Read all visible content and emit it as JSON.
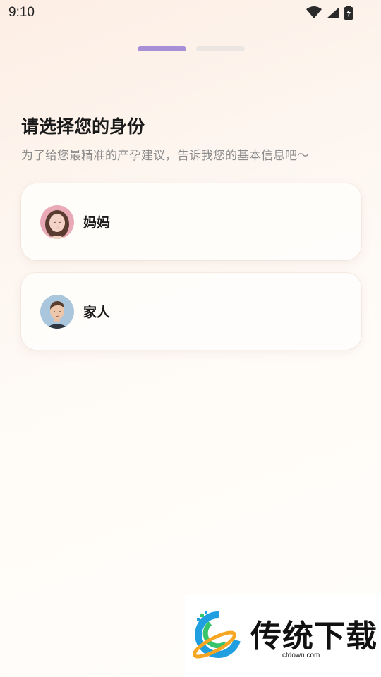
{
  "status_bar": {
    "time": "9:10",
    "icons": [
      "wifi-icon",
      "cellular-signal-icon",
      "battery-charging-icon"
    ]
  },
  "pager": {
    "count": 2,
    "active_index": 0,
    "active_color": "#a98fd6",
    "inactive_color": "#ebe6e2"
  },
  "header": {
    "title": "请选择您的身份",
    "subtitle": "为了给您最精准的产孕建议，告诉我您的基本信息吧～"
  },
  "identity_options": [
    {
      "label": "妈妈",
      "avatar": "woman-avatar"
    },
    {
      "label": "家人",
      "avatar": "man-avatar"
    }
  ],
  "watermark": {
    "brand": "传统下载",
    "url": "ctdown.com"
  }
}
